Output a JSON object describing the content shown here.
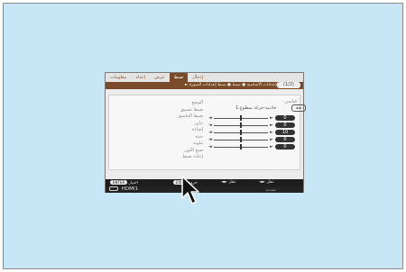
{
  "menu": {
    "tabs": [
      "إدخال",
      "ضبط",
      "عرض",
      "إعداد",
      "معلومات"
    ],
    "active_tab_index": 1,
    "breadcrumb": "◄ الإعدادات الأساسية ● ضبط ● ضبط إعدادات الصورة ►",
    "page_indicator": "(1/2)",
    "labels": [
      "الوضع",
      "ضبط تسبيق",
      "ضبط التناسق",
      "تباين",
      "إضاءة",
      "حدة",
      "ملونة",
      "صبغ اللون",
      "إعادة ضبط"
    ],
    "preset": {
      "label": "قياسي",
      "value": "1:جاذبية-حركة سطوع",
      "stepper": "◄ ►"
    },
    "sliders": [
      {
        "name": "contrast",
        "value": "0",
        "level": 0.5
      },
      {
        "name": "brightness",
        "value": "0",
        "level": 0.5
      },
      {
        "name": "sharpness",
        "value": "10",
        "level": 0.5
      },
      {
        "name": "color",
        "value": "0",
        "level": 0.5
      },
      {
        "name": "hue",
        "value": "0",
        "level": 0.5
      }
    ]
  },
  "footer": {
    "enter_key": "ENTER",
    "enter_label": "اختيار",
    "exit_key": "EXIT",
    "exit_label": "خروج",
    "left_label": "تنقل",
    "right_label": "تنقل"
  },
  "source": {
    "label": "HDMI1",
    "advanced": "متقدمة"
  }
}
